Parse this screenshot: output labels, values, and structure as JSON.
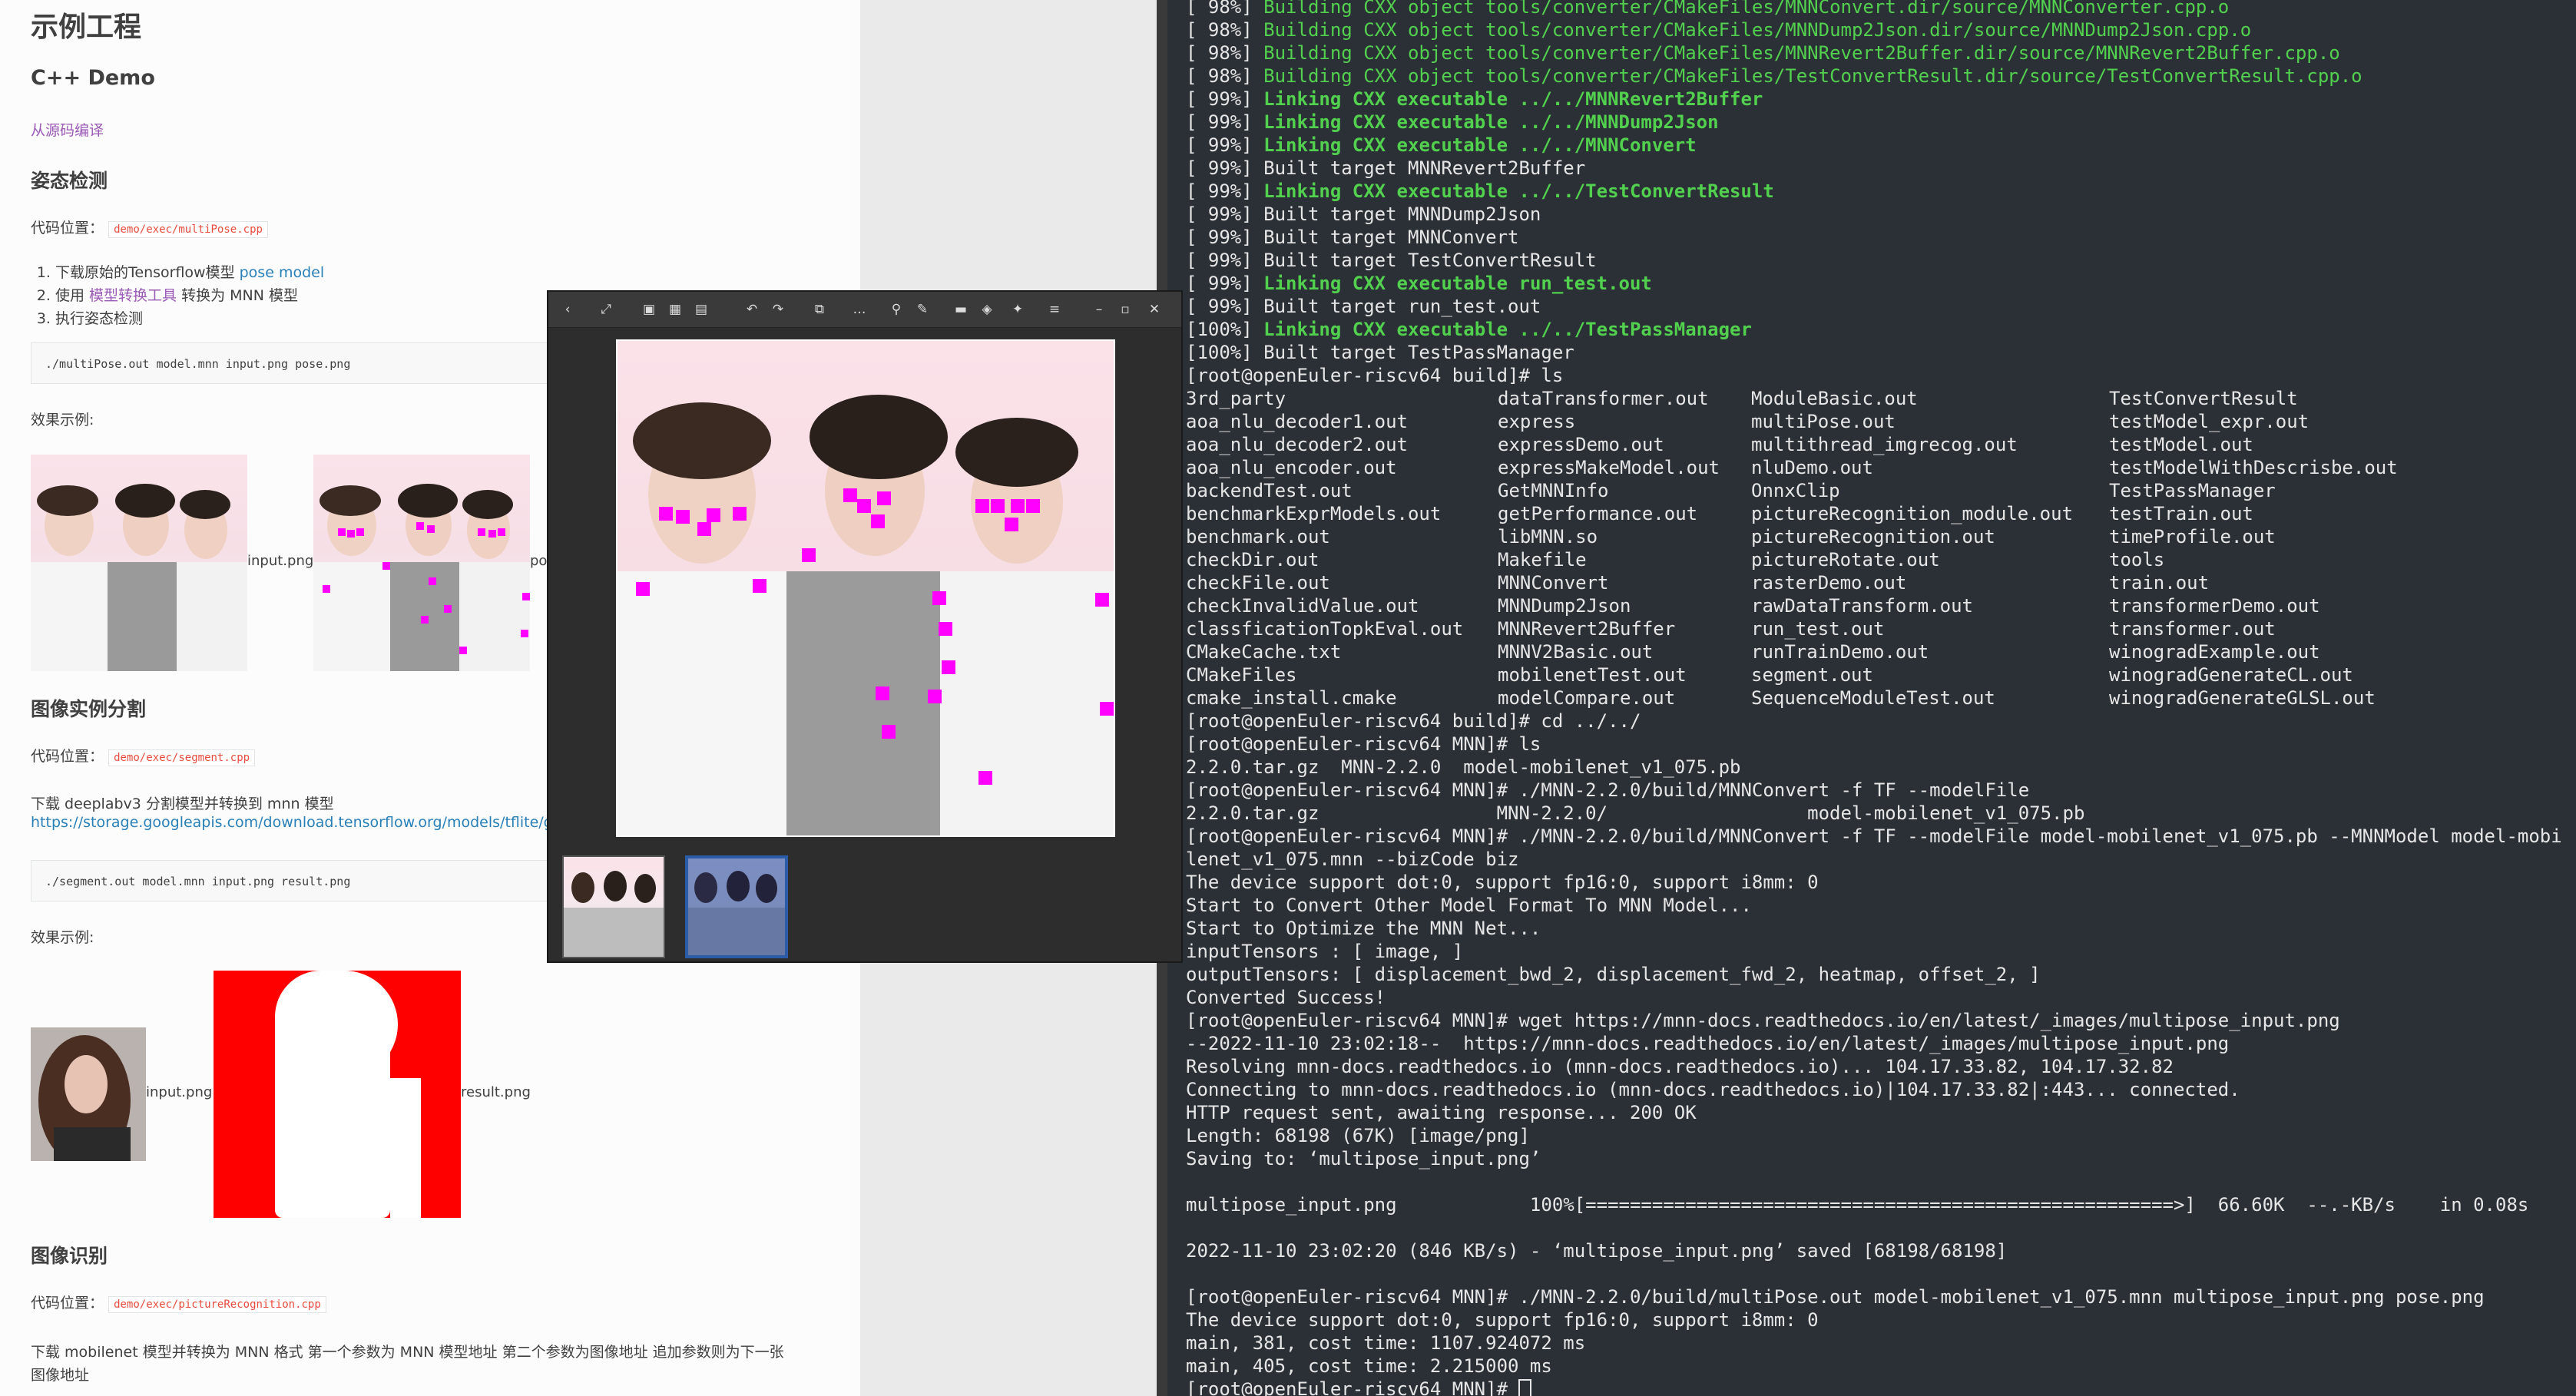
{
  "doc": {
    "title": "示例工程",
    "cpp_demo": "C++ Demo",
    "build_link": "从源码编译",
    "pose_heading": "姿态检测",
    "code_location_label": "代码位置：",
    "pose_code_path": "demo/exec/multiPose.cpp",
    "pose_steps": [
      {
        "pre": "下载原始的Tensorflow模型 ",
        "link": "pose model",
        "post": ""
      },
      {
        "pre": "使用 ",
        "link": "模型转换工具",
        "post": " 转换为 MNN 模型"
      },
      {
        "pre": "执行姿态检测",
        "link": "",
        "post": ""
      }
    ],
    "pose_cmd": "./multiPose.out model.mnn input.png pose.png",
    "effect_label": "效果示例:",
    "pose_input_label": "input.png",
    "pose_output_label": "po",
    "seg_heading": "图像实例分割",
    "seg_code_path": "demo/exec/segment.cpp",
    "seg_download": "下载 deeplabv3 分割模型并转换到 mnn 模型",
    "seg_url": "https://storage.googleapis.com/download.tensorflow.org/models/tflite/gpu/d",
    "seg_cmd": "./segment.out model.mnn input.png result.png",
    "seg_input_label": "input.png",
    "seg_result_label": "result.png",
    "recog_heading": "图像识别",
    "recog_code_path": "demo/exec/pictureRecognition.cpp",
    "recog_desc_1": "下载 mobilenet 模型并转换为 MNN 格式 第一个参数为 MNN 模型地址 第二个参数为图像地址 追加参数则为下一张",
    "recog_desc_2": "图像地址"
  },
  "viewer": {
    "toolbar_icons": [
      "back-icon",
      "fullscreen-icon",
      "single-view-icon",
      "grid-view-icon",
      "add-icon",
      "rotate-left-icon",
      "rotate-right-icon",
      "crop-icon",
      "more-icon",
      "pin-icon",
      "edit-icon",
      "comment-icon",
      "tag-icon",
      "tools-icon",
      "menu-icon",
      "minimize-icon",
      "maximize-icon",
      "close-icon"
    ],
    "toolbar_glyphs": [
      "‹",
      "⤢",
      "▣",
      "▦",
      "▤",
      "↶",
      "↷",
      "⧉",
      "…",
      "⚲",
      "✎",
      "▬",
      "◈",
      "✦",
      "≡",
      "–",
      "▫",
      "✕"
    ]
  },
  "terminal": {
    "lines": [
      {
        "t": "[ 98%] ",
        "g": "Building CXX object tools/converter/CMakeFiles/MNNConvert.dir/source/MNNConverter.cpp.o",
        "style": "g"
      },
      {
        "t": "[ 98%] ",
        "g": "Building CXX object tools/converter/CMakeFiles/MNNDump2Json.dir/source/MNNDump2Json.cpp.o",
        "style": "g"
      },
      {
        "t": "[ 98%] ",
        "g": "Building CXX object tools/converter/CMakeFiles/MNNRevert2Buffer.dir/source/MNNRevert2Buffer.cpp.o",
        "style": "g"
      },
      {
        "t": "[ 98%] ",
        "g": "Building CXX object tools/converter/CMakeFiles/TestConvertResult.dir/source/TestConvertResult.cpp.o",
        "style": "g"
      },
      {
        "t": "[ 99%] ",
        "g": "Linking CXX executable ../../MNNRevert2Buffer",
        "style": "gb"
      },
      {
        "t": "[ 99%] ",
        "g": "Linking CXX executable ../../MNNDump2Json",
        "style": "gb"
      },
      {
        "t": "[ 99%] ",
        "g": "Linking CXX executable ../../MNNConvert",
        "style": "gb"
      },
      {
        "t": "[ 99%] Built target MNNRevert2Buffer",
        "g": "",
        "style": ""
      },
      {
        "t": "[ 99%] ",
        "g": "Linking CXX executable ../../TestConvertResult",
        "style": "gb"
      },
      {
        "t": "[ 99%] Built target MNNDump2Json",
        "g": "",
        "style": ""
      },
      {
        "t": "[ 99%] Built target MNNConvert",
        "g": "",
        "style": ""
      },
      {
        "t": "[ 99%] Built target TestConvertResult",
        "g": "",
        "style": ""
      },
      {
        "t": "[ 99%] ",
        "g": "Linking CXX executable run_test.out",
        "style": "gb"
      },
      {
        "t": "[ 99%] Built target run_test.out",
        "g": "",
        "style": ""
      },
      {
        "t": "[100%] ",
        "g": "Linking CXX executable ../../TestPassManager",
        "style": "gb"
      },
      {
        "t": "[100%] Built target TestPassManager",
        "g": "",
        "style": ""
      },
      {
        "t": "[root@openEuler-riscv64 build]# ls",
        "g": "",
        "style": ""
      }
    ],
    "ls_cols": [
      [
        "3rd_party",
        "aoa_nlu_decoder1.out",
        "aoa_nlu_decoder2.out",
        "aoa_nlu_encoder.out",
        "backendTest.out",
        "benchmarkExprModels.out",
        "benchmark.out",
        "checkDir.out",
        "checkFile.out",
        "checkInvalidValue.out",
        "classficationTopkEval.out",
        "CMakeCache.txt",
        "CMakeFiles",
        "cmake_install.cmake"
      ],
      [
        "dataTransformer.out",
        "express",
        "expressDemo.out",
        "expressMakeModel.out",
        "GetMNNInfo",
        "getPerformance.out",
        "libMNN.so",
        "Makefile",
        "MNNConvert",
        "MNNDump2Json",
        "MNNRevert2Buffer",
        "MNNV2Basic.out",
        "mobilenetTest.out",
        "modelCompare.out"
      ],
      [
        "ModuleBasic.out",
        "multiPose.out",
        "multithread_imgrecog.out",
        "nluDemo.out",
        "OnnxClip",
        "pictureRecognition_module.out",
        "pictureRecognition.out",
        "pictureRotate.out",
        "rasterDemo.out",
        "rawDataTransform.out",
        "run_test.out",
        "runTrainDemo.out",
        "segment.out",
        "SequenceModuleTest.out"
      ],
      [
        "TestConvertResult",
        "testModel_expr.out",
        "testModel.out",
        "testModelWithDescrisbe.out",
        "TestPassManager",
        "testTrain.out",
        "timeProfile.out",
        "tools",
        "train.out",
        "transformerDemo.out",
        "transformer.out",
        "winogradExample.out",
        "winogradGenerateCL.out",
        "winogradGenerateGLSL.out"
      ]
    ],
    "after": [
      "[root@openEuler-riscv64 build]# cd ../../",
      "[root@openEuler-riscv64 MNN]# ls",
      "2.2.0.tar.gz  MNN-2.2.0  model-mobilenet_v1_075.pb",
      "[root@openEuler-riscv64 MNN]# ./MNN-2.2.0/build/MNNConvert -f TF --modelFile",
      "2.2.0.tar.gz                MNN-2.2.0/                  model-mobilenet_v1_075.pb",
      "[root@openEuler-riscv64 MNN]# ./MNN-2.2.0/build/MNNConvert -f TF --modelFile model-mobilenet_v1_075.pb --MNNModel model-mobi",
      "lenet_v1_075.mnn --bizCode biz",
      "The device support dot:0, support fp16:0, support i8mm: 0",
      "Start to Convert Other Model Format To MNN Model...",
      "Start to Optimize the MNN Net...",
      "inputTensors : [ image, ]",
      "outputTensors: [ displacement_bwd_2, displacement_fwd_2, heatmap, offset_2, ]",
      "Converted Success!",
      "[root@openEuler-riscv64 MNN]# wget https://mnn-docs.readthedocs.io/en/latest/_images/multipose_input.png",
      "--2022-11-10 23:02:18--  https://mnn-docs.readthedocs.io/en/latest/_images/multipose_input.png",
      "Resolving mnn-docs.readthedocs.io (mnn-docs.readthedocs.io)... 104.17.33.82, 104.17.32.82",
      "Connecting to mnn-docs.readthedocs.io (mnn-docs.readthedocs.io)|104.17.33.82|:443... connected.",
      "HTTP request sent, awaiting response... 200 OK",
      "Length: 68198 (67K) [image/png]",
      "Saving to: ‘multipose_input.png’",
      "",
      "multipose_input.png            100%[=====================================================>]  66.60K  --.-KB/s    in 0.08s",
      "",
      "2022-11-10 23:02:20 (846 KB/s) - ‘multipose_input.png’ saved [68198/68198]",
      "",
      "[root@openEuler-riscv64 MNN]# ./MNN-2.2.0/build/multiPose.out model-mobilenet_v1_075.mnn multipose_input.png pose.png",
      "The device support dot:0, support fp16:0, support i8mm: 0",
      "main, 381, cost time: 1107.924072 ms",
      "main, 405, cost time: 2.215000 ms",
      "[root@openEuler-riscv64 MNN]# "
    ]
  }
}
